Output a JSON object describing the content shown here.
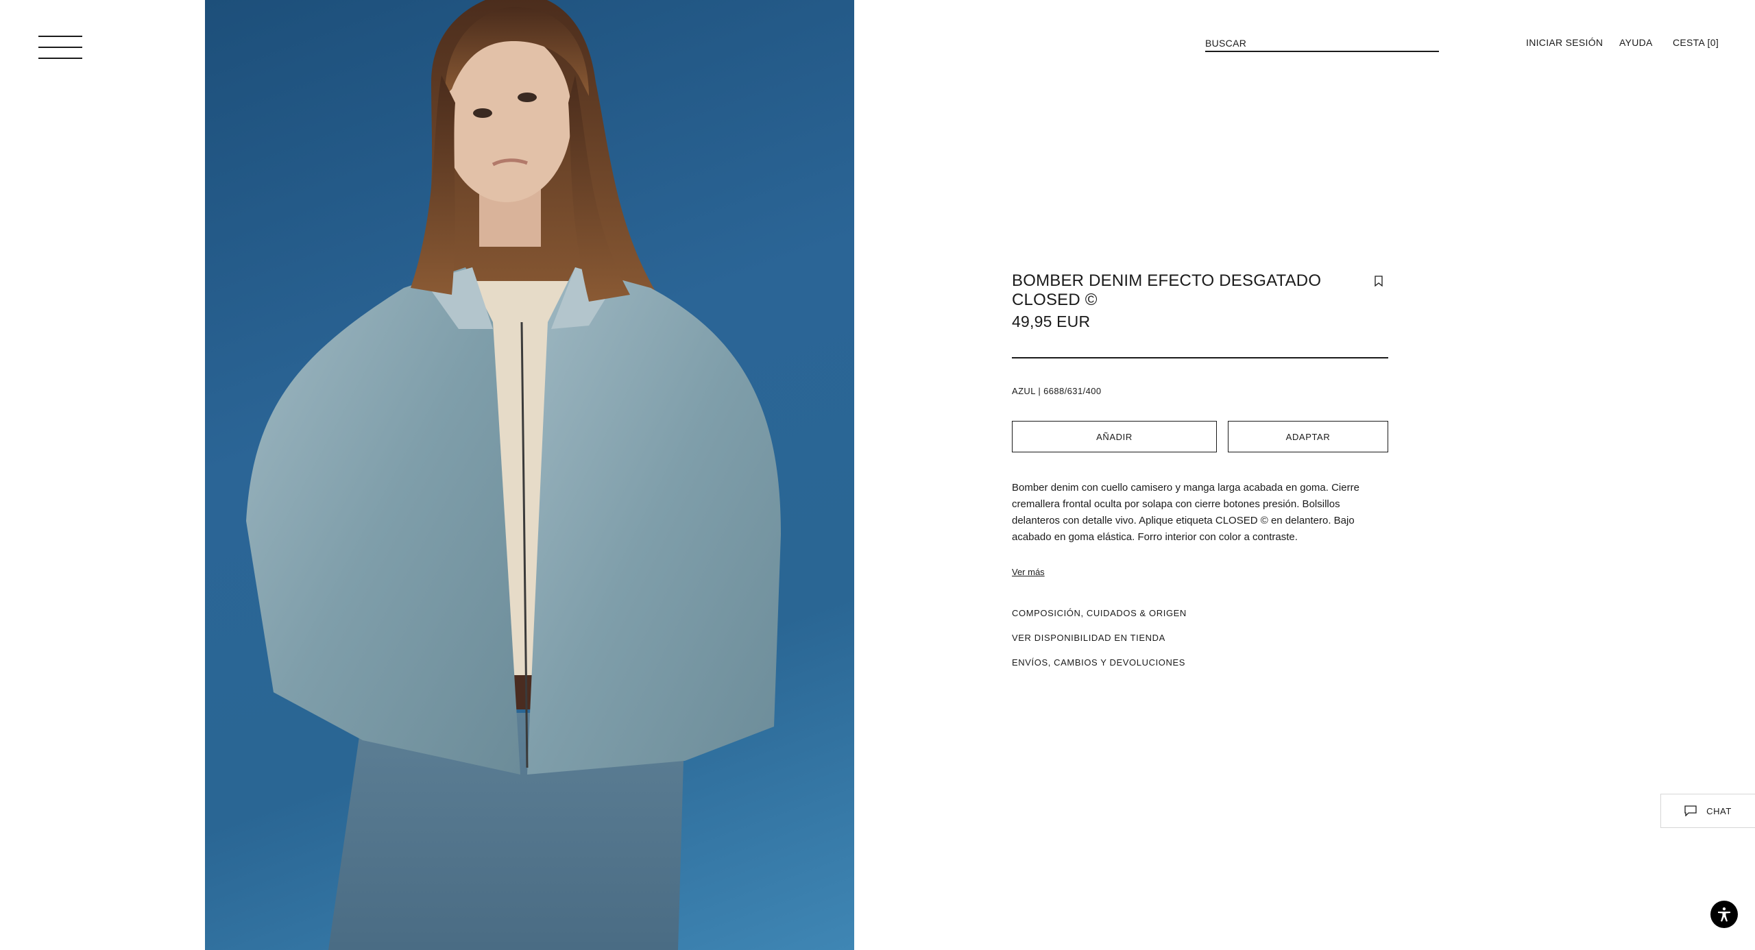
{
  "header": {
    "search_label": "BUSCAR",
    "login": "INICIAR SESIÓN",
    "help": "AYUDA",
    "cart": "CESTA [0]"
  },
  "product": {
    "title": "BOMBER DENIM EFECTO DESGATADO CLOSED ©",
    "price": "49,95 EUR",
    "reference": "AZUL | 6688/631/400",
    "add_label": "AÑADIR",
    "adapt_label": "ADAPTAR",
    "description": "Bomber denim con cuello camisero y manga larga acabada en goma. Cierre cremallera frontal oculta por solapa con cierre botones presión. Bolsillos delanteros con detalle vivo. Aplique etiqueta CLOSED © en delantero. Bajo acabado en goma elástica. Forro interior con color a contraste.",
    "see_more": "Ver más",
    "links": [
      "COMPOSICIÓN, CUIDADOS & ORIGEN",
      "VER DISPONIBILIDAD EN TIENDA",
      "ENVÍOS, CAMBIOS Y DEVOLUCIONES"
    ]
  },
  "chat": {
    "label": "CHAT"
  },
  "icons": {
    "menu": "hamburger-menu-icon",
    "bookmark": "bookmark-icon",
    "chat": "chat-bubble-icon",
    "accessibility": "accessibility-icon"
  },
  "colors": {
    "text": "#1a1a1a",
    "background": "#ffffff",
    "photo_background": "#2b6596"
  }
}
